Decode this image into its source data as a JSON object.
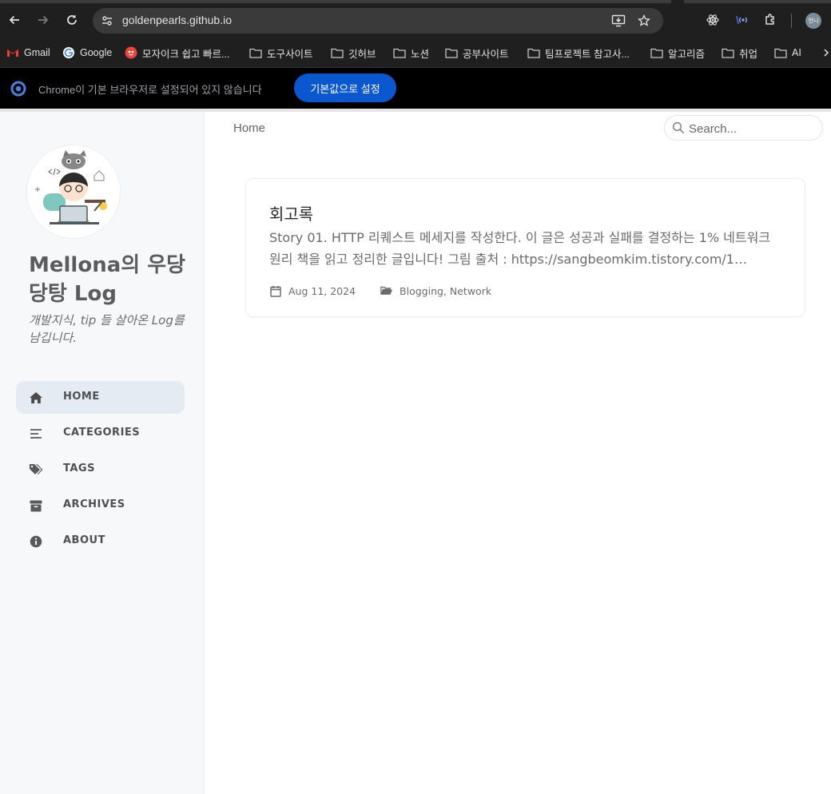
{
  "browser": {
    "url": "goldenpearls.github.io",
    "profile_initials": "언니",
    "bookmarks": [
      {
        "label": "Gmail",
        "icon": "gmail-icon"
      },
      {
        "label": "Google",
        "icon": "google-icon"
      },
      {
        "label": "모자이크 쉽고 빠르...",
        "icon": "mosaic-site-icon"
      },
      {
        "label": "도구사이트",
        "icon": "folder-icon"
      },
      {
        "label": "깃허브",
        "icon": "folder-icon"
      },
      {
        "label": "노션",
        "icon": "folder-icon"
      },
      {
        "label": "공부사이트",
        "icon": "folder-icon"
      },
      {
        "label": "팀프로젝트 참고사...",
        "icon": "folder-icon"
      },
      {
        "label": "알고리즘",
        "icon": "folder-icon"
      },
      {
        "label": "취업",
        "icon": "folder-icon"
      },
      {
        "label": "AI",
        "icon": "folder-icon"
      }
    ],
    "infobar": {
      "message": "Chrome이 기본 브라우저로 설정되어 있지 않습니다",
      "button": "기본값으로 설정"
    }
  },
  "sidebar": {
    "title": "Mellona의 우당당탕 Log",
    "subtitle": "개발지식, tip 들 살아온 Log를 남깁니다.",
    "nav": [
      {
        "label": "HOME",
        "icon": "home-icon",
        "active": true
      },
      {
        "label": "CATEGORIES",
        "icon": "stream-icon",
        "active": false
      },
      {
        "label": "TAGS",
        "icon": "tags-icon",
        "active": false
      },
      {
        "label": "ARCHIVES",
        "icon": "archive-icon",
        "active": false
      },
      {
        "label": "ABOUT",
        "icon": "info-icon",
        "active": false
      }
    ]
  },
  "topbar": {
    "breadcrumb": "Home",
    "search_placeholder": "Search..."
  },
  "posts": [
    {
      "title": "회고록",
      "excerpt": "Story 01. HTTP 리퀘스트 메세지를 작성한다. 이 글은 성공과 실패를 결정하는 1% 네트워크 원리 책을 읽고 정리한 글입니다! 그림 출처 : https://sangbeomkim.tistory.com/1…",
      "date": "Aug 11, 2024",
      "categories": "Blogging, Network"
    }
  ],
  "colors": {
    "sidebar_bg": "#f6f8fa",
    "active_nav_bg": "#e4ebf2",
    "chrome_bg": "#1f1f1f",
    "infobar_button": "#0b57d0"
  }
}
